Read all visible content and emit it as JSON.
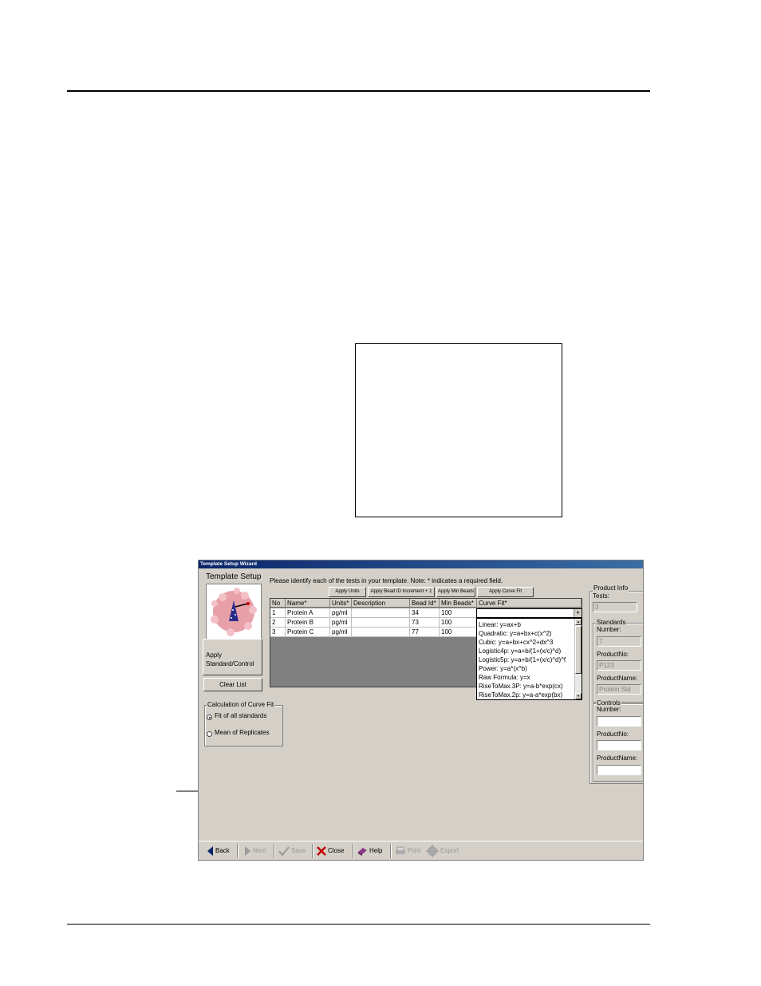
{
  "window": {
    "title": "Template Setup Wizard"
  },
  "sidebar": {
    "heading": "Template Setup",
    "apply_standard_label": "Apply Standard/Control",
    "clear_list_label": "Clear List",
    "curve_fit_group": {
      "label": "Calculation of Curve Fit",
      "options": [
        {
          "label": "Fit of all standards",
          "selected": true
        },
        {
          "label": "Mean of Replicates",
          "selected": false
        }
      ]
    }
  },
  "main": {
    "instruction": "Please identify each of the tests in your template.  Note: * indicates a required field.",
    "buttons": {
      "apply_units": "Apply Units",
      "apply_bead_id": "Apply Bead ID Increment + 1",
      "apply_min_beads": "Apply Min Beads",
      "apply_curve_fit": "Apply Curve Fit"
    },
    "table": {
      "headers": [
        "No",
        "Name*",
        "Units*",
        "Description",
        "Bead Id*",
        "Min Beads*",
        "Curve Fit*"
      ],
      "rows": [
        [
          "1",
          "Protein A",
          "pg/ml",
          "",
          "34",
          "100",
          ""
        ],
        [
          "2",
          "Protein B",
          "pg/ml",
          "",
          "73",
          "100",
          ""
        ],
        [
          "3",
          "Protein C",
          "pg/ml",
          "",
          "77",
          "100",
          ""
        ]
      ]
    },
    "curve_fit_options": [
      "Linear: y=ax+b",
      "Quadratic: y=a+bx+c(x^2)",
      "Cubic: y=a+bx+cx^2+dx^3",
      "Logistic4p: y=a+b/(1+(x/c)^d)",
      "Logistic5p: y=a+b/(1+(x/c)^d)^f",
      "Power: y=a*(x^b)",
      "Raw Formula: y=x",
      "RiseToMax.3P: y=a-b*exp(cx)",
      "RiseToMax.2p: y=a-a*exp(bx)"
    ]
  },
  "product_info": {
    "label": "Product Info",
    "tests_label": "Tests:",
    "tests_value": "3",
    "standards": {
      "label": "Standards",
      "number_label": "Number:",
      "number_value": "7",
      "product_no_label": "ProductNo:",
      "product_no_value": "P123",
      "product_name_label": "ProductName:",
      "product_name_value": "Protein Std"
    },
    "controls": {
      "label": "Controls",
      "number_label": "Number:",
      "number_value": "",
      "product_no_label": "ProductNo:",
      "product_no_value": "",
      "product_name_label": "ProductName:",
      "product_name_value": ""
    }
  },
  "toolbar": {
    "back": "Back",
    "next": "Next",
    "save": "Save",
    "close": "Close",
    "help": "Help",
    "print": "Print",
    "export": "Export"
  },
  "colors": {
    "titlebar": "#0a246a",
    "window_bg": "#d4d0c8",
    "grid_bg": "#808080"
  }
}
